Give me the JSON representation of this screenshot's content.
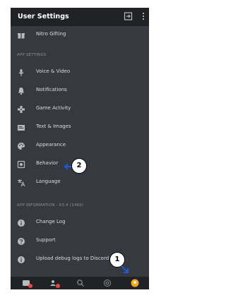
{
  "header": {
    "title": "User Settings",
    "exit_icon": "exit-icon",
    "more_icon": "more-vertical-icon"
  },
  "rows_top": [
    {
      "label": "Nitro Gifting",
      "icon": "gift-icon"
    }
  ],
  "section_app": "APP SETTINGS",
  "app_settings": [
    {
      "label": "Voice & Video",
      "icon": "microphone-icon"
    },
    {
      "label": "Notifications",
      "icon": "bell-icon"
    },
    {
      "label": "Game Activity",
      "icon": "gamepad-icon"
    },
    {
      "label": "Text & Images",
      "icon": "image-icon"
    },
    {
      "label": "Appearance",
      "icon": "palette-icon"
    },
    {
      "label": "Behavior",
      "icon": "behavior-icon"
    },
    {
      "label": "Language",
      "icon": "language-icon"
    }
  ],
  "section_info": "APP INFORMATION - 63.4 (1460)",
  "app_info": [
    {
      "label": "Change Log",
      "icon": "info-icon"
    },
    {
      "label": "Support",
      "icon": "help-icon"
    },
    {
      "label": "Upload debug logs to Discord Su",
      "icon": "info-icon"
    }
  ],
  "bottom_nav": [
    {
      "icon": "home-icon",
      "badge": "red"
    },
    {
      "icon": "friends-icon",
      "badge": "red"
    },
    {
      "icon": "search-icon"
    },
    {
      "icon": "mentions-icon"
    },
    {
      "icon": "profile-avatar-icon"
    }
  ],
  "callouts": [
    "1",
    "2"
  ],
  "colors": {
    "bg": "#36393f",
    "header": "#202225",
    "text": "#dcddde",
    "section": "#8e9297",
    "accent": "#faa61a"
  }
}
